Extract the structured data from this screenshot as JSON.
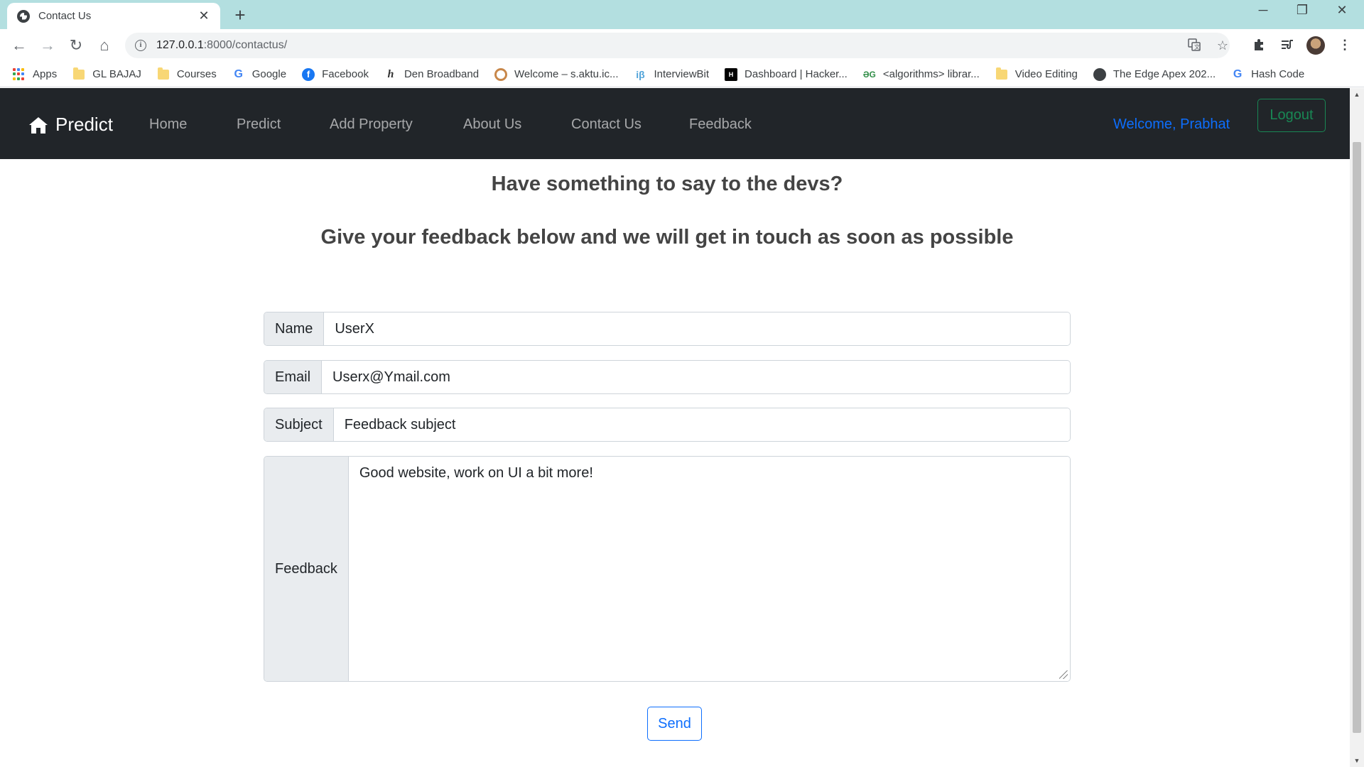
{
  "browser": {
    "tab_title": "Contact Us",
    "tab_close": "✕",
    "new_tab": "+",
    "window_controls": [
      "─",
      "❐",
      "✕"
    ],
    "url_host": "127.0.0.1",
    "url_path": ":8000/contactus/",
    "nav": {
      "back": "←",
      "forward": "→",
      "reload": "↻",
      "home": "⌂"
    },
    "icons": [
      "translate-icon",
      "star-icon",
      "extensions-icon",
      "media-icon",
      "profile-avatar",
      "menu-icon"
    ]
  },
  "bookmarks": [
    {
      "label": "Apps",
      "icon": "apps-icon"
    },
    {
      "label": "GL BAJAJ",
      "icon": "folder-icon"
    },
    {
      "label": "Courses",
      "icon": "folder-icon"
    },
    {
      "label": "Google",
      "icon": "google-icon"
    },
    {
      "label": "Facebook",
      "icon": "facebook-icon"
    },
    {
      "label": "Den Broadband",
      "icon": "den-icon"
    },
    {
      "label": "Welcome – s.aktu.ic...",
      "icon": "aktu-icon"
    },
    {
      "label": "InterviewBit",
      "icon": "interviewbit-icon"
    },
    {
      "label": "Dashboard | Hacker...",
      "icon": "hackerrank-icon"
    },
    {
      "label": "<algorithms> librar...",
      "icon": "gfg-icon"
    },
    {
      "label": "Video Editing",
      "icon": "folder-icon"
    },
    {
      "label": "The Edge Apex 202...",
      "icon": "globe-icon"
    },
    {
      "label": "Hash Code",
      "icon": "google-icon"
    }
  ],
  "navbar": {
    "brand": "Predict",
    "links": [
      "Home",
      "Predict",
      "Add Property",
      "About Us",
      "Contact Us",
      "Feedback"
    ],
    "welcome": "Welcome, Prabhat",
    "logout": "Logout"
  },
  "content": {
    "heading1": "Have something to say to the devs?",
    "heading2": "Give your feedback below and we will get in touch as soon as possible"
  },
  "form": {
    "name_label": "Name",
    "name_value": "UserX",
    "email_label": "Email",
    "email_value": "Userx@Ymail.com",
    "subject_label": "Subject",
    "subject_value": "Feedback subject",
    "feedback_label": "Feedback",
    "feedback_value": "Good website, work on UI a bit more!",
    "send": "Send"
  },
  "colors": {
    "tabbar": "#b3dfe0",
    "navbar": "#212529",
    "primary": "#0d6efd",
    "success": "#198754"
  }
}
